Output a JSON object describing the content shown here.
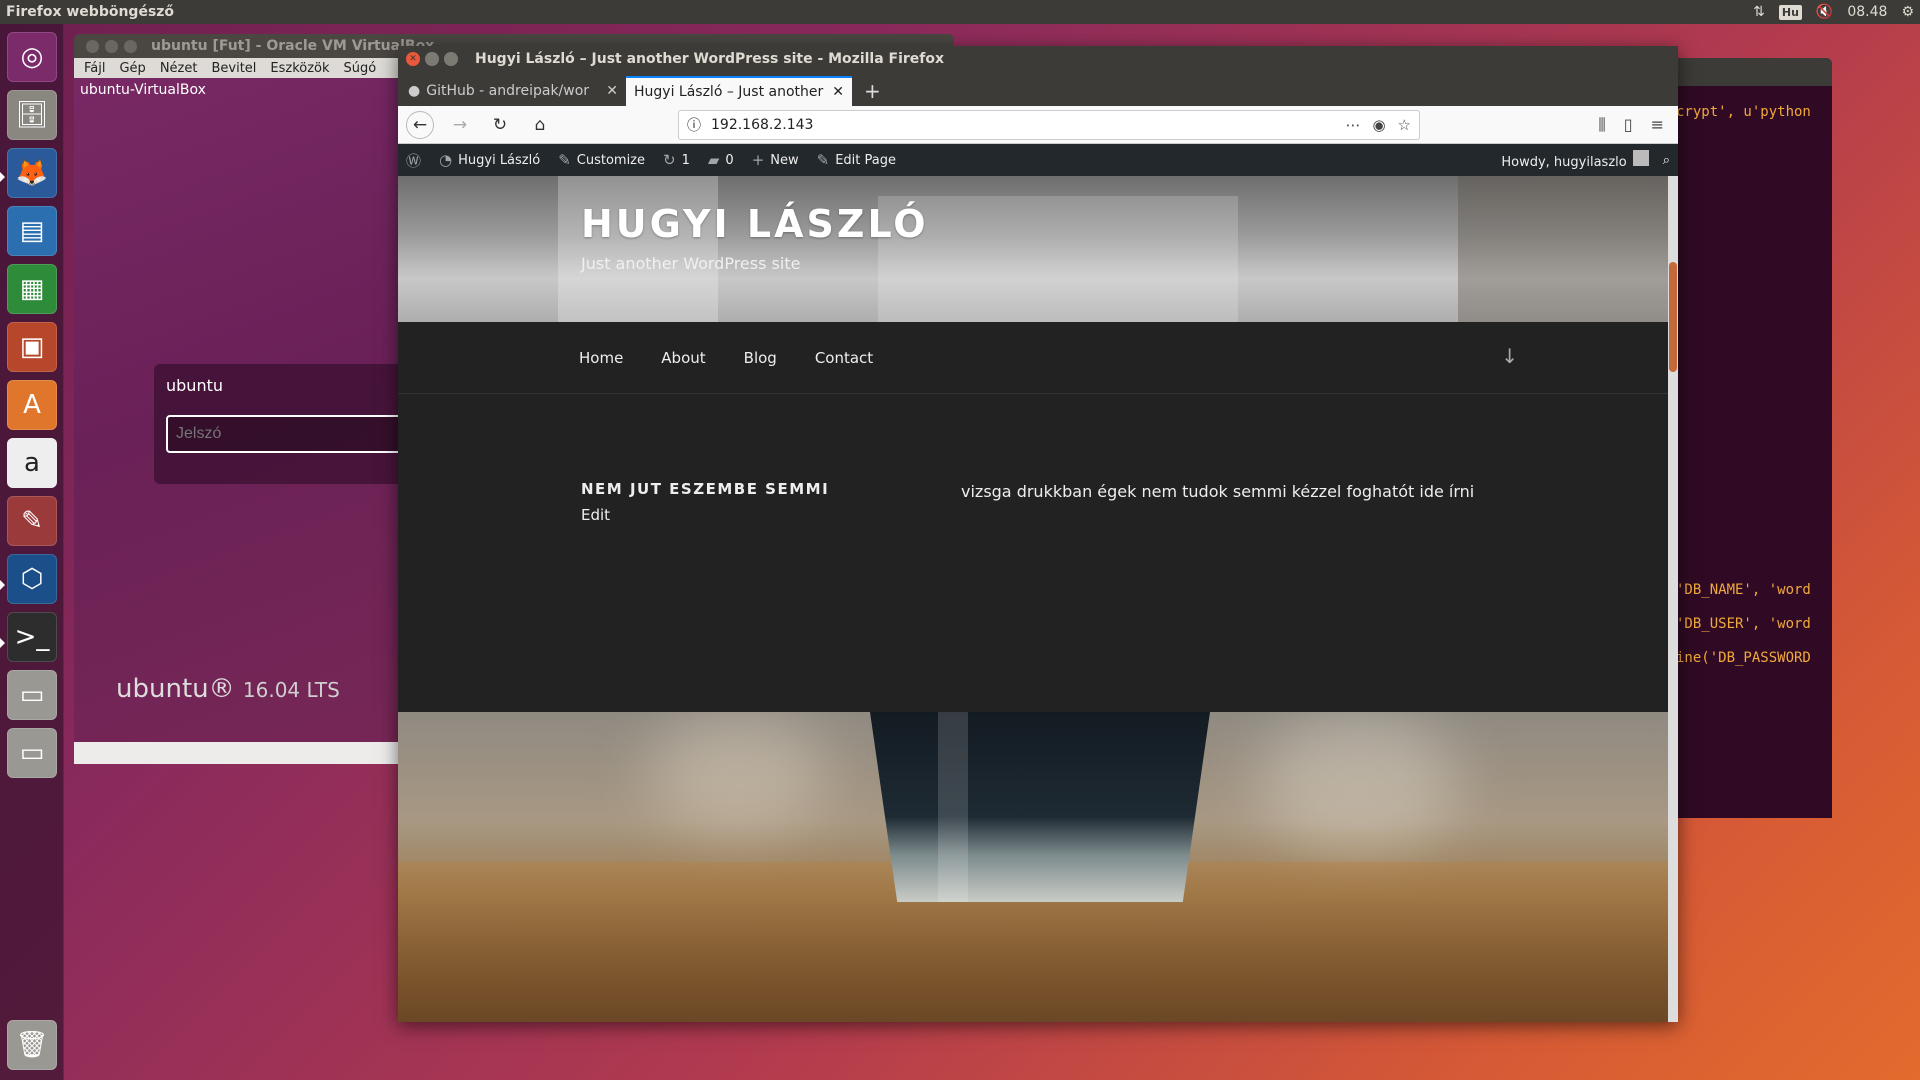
{
  "top_panel": {
    "app_name": "Firefox webböngésző",
    "keyboard": "Hu",
    "time": "08.48"
  },
  "launcher": {
    "items": [
      "ubuntu-dash",
      "files",
      "firefox",
      "writer",
      "calc",
      "impress",
      "software-center",
      "amazon",
      "system-settings",
      "virtualbox",
      "terminal",
      "drive",
      "drive",
      "trash"
    ]
  },
  "vbox": {
    "title": "ubuntu [Fut] - Oracle VM VirtualBox",
    "menu": [
      "Fájl",
      "Gép",
      "Nézet",
      "Bevitel",
      "Eszközök",
      "Súgó"
    ],
    "hostname": "ubuntu-VirtualBox",
    "login_user": "ubuntu",
    "password_placeholder": "Jelszó",
    "brand": "ubuntu®",
    "version": "16.04 LTS"
  },
  "terminal": {
    "lines": [
      "crypt', u'python",
      "'DB_NAME', 'word",
      "'DB_USER', 'word",
      "ine('DB_PASSWORD"
    ]
  },
  "firefox": {
    "window_title": "Hugyi László – Just another WordPress site - Mozilla Firefox",
    "tabs": [
      {
        "label": "GitHub - andreipak/wor"
      },
      {
        "label": "Hugyi László – Just another"
      }
    ],
    "url": "192.168.2.143"
  },
  "wp_admin": {
    "site": "Hugyi László",
    "customize": "Customize",
    "updates": "1",
    "comments": "0",
    "new": "New",
    "edit_page": "Edit Page",
    "howdy": "Howdy, hugyilaszlo"
  },
  "site": {
    "title": "HUGYI LÁSZLÓ",
    "description": "Just another WordPress site",
    "nav": [
      "Home",
      "About",
      "Blog",
      "Contact"
    ]
  },
  "post": {
    "title": "NEM JUT ESZEMBE SEMMI",
    "edit": "Edit",
    "body": "vizsga drukkban égek nem tudok semmi kézzel foghatót ide írni"
  }
}
